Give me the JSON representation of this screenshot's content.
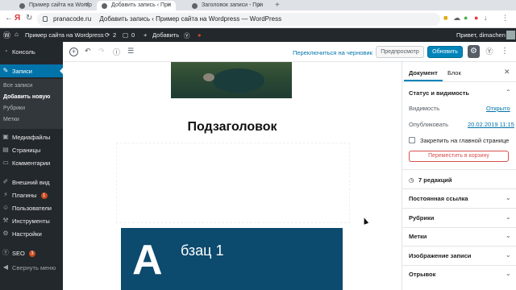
{
  "browser": {
    "tabs": [
      {
        "label": "Пример сайта на Wordp",
        "active": false
      },
      {
        "label": "Добавить запись ‹ При",
        "active": true
      },
      {
        "label": "Заголовок записи - При",
        "active": false
      }
    ],
    "address_domain": "pranacode.ru",
    "address_title": "Добавить запись ‹ Пример сайта на Wordpress — WordPress",
    "ext_cloud": "☁",
    "ext_download": "↓"
  },
  "admin_bar": {
    "site_name": "Пример сайта на Wordpress",
    "updates": "2",
    "comments": "0",
    "add_new": "Добавить",
    "greeting": "Привет, dimachen"
  },
  "sidebar": {
    "items": [
      {
        "label": "Консоль",
        "icon": "dashboard-icon"
      },
      {
        "label": "Записи",
        "icon": "pin-icon"
      },
      {
        "label": "Медиафайлы",
        "icon": "media-icon"
      },
      {
        "label": "Страницы",
        "icon": "pages-icon"
      },
      {
        "label": "Комментарии",
        "icon": "comments-icon"
      },
      {
        "label": "Внешний вид",
        "icon": "brush-icon"
      },
      {
        "label": "Плагины",
        "icon": "plugin-icon",
        "badge": "1"
      },
      {
        "label": "Пользователи",
        "icon": "users-icon"
      },
      {
        "label": "Инструменты",
        "icon": "wrench-icon"
      },
      {
        "label": "Настройки",
        "icon": "settings-icon"
      },
      {
        "label": "SEO",
        "icon": "yoast-icon",
        "badge": "3"
      },
      {
        "label": "Свернуть меню",
        "icon": "collapse-icon"
      }
    ],
    "submenu": [
      "Все записи",
      "Добавить новую",
      "Рубрики",
      "Метки"
    ]
  },
  "editor_toolbar": {
    "switch_to_draft": "Переключиться на черновик",
    "preview": "Предпросмотр",
    "update": "Обновить"
  },
  "content": {
    "heading": "Подзаголовок",
    "dropcap": "А",
    "paragraph": "бзац 1"
  },
  "panel": {
    "tab_document": "Документ",
    "tab_block": "Блок",
    "status_title": "Статус и видимость",
    "visibility_label": "Видимость",
    "visibility_value": "Открыто",
    "published_label": "Опубликовать",
    "published_value": "20.02.2019 11:15",
    "stick_label": "Закрепить на главной странице",
    "trash_button": "Переместить в корзину",
    "revisions": "7 редакций",
    "sections": [
      "Постоянная ссылка",
      "Рубрики",
      "Метки",
      "Изображение записи",
      "Отрывок"
    ]
  }
}
